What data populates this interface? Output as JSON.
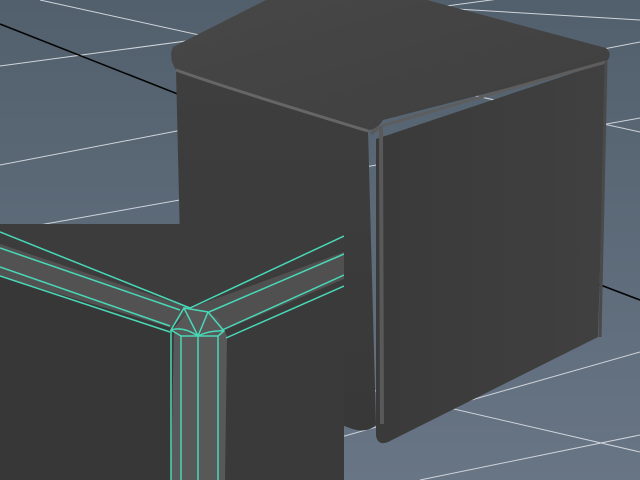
{
  "viewport": {
    "background_gradient": [
      "#52606d",
      "#687585"
    ],
    "grid_line_color": "#d4d9df",
    "axis_line_color": "#050505"
  },
  "object": {
    "name": "beveled-cube",
    "face_colors": {
      "top": "#424242",
      "front": "#3d3d3d",
      "side": "#3a3a3a"
    },
    "bevel_highlight_color": "#6b6b6b"
  },
  "zoom_inset": {
    "name": "corner-wireframe-closeup",
    "background_color": "#3b3b3b",
    "wireframe_color": "#49d8b7"
  }
}
